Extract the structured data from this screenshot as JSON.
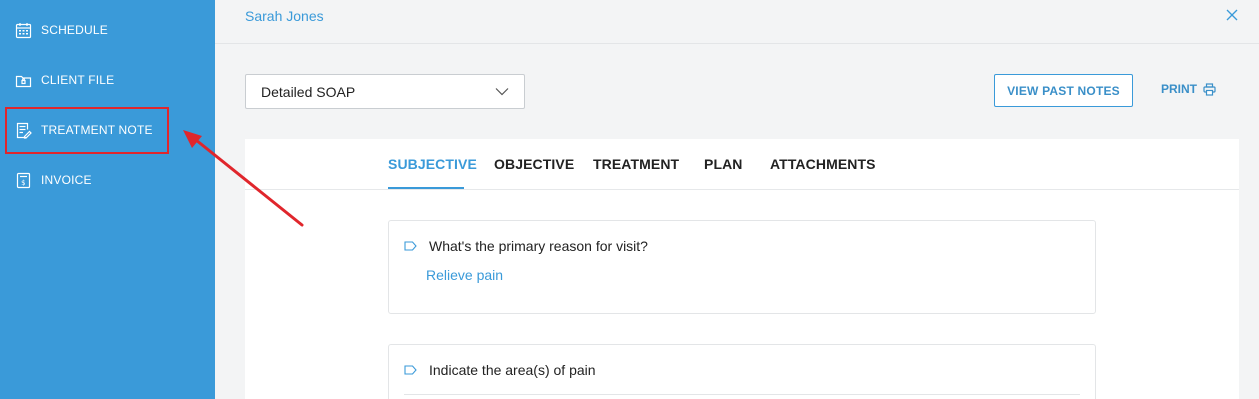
{
  "sidebar": {
    "items": [
      {
        "label": "SCHEDULE",
        "icon": "calendar-icon"
      },
      {
        "label": "CLIENT FILE",
        "icon": "folder-icon"
      },
      {
        "label": "TREATMENT NOTE",
        "icon": "note-edit-icon"
      },
      {
        "label": "INVOICE",
        "icon": "invoice-icon"
      }
    ],
    "highlighted_item": "TREATMENT NOTE"
  },
  "header": {
    "client_name": "Sarah Jones",
    "close_icon": "close-icon"
  },
  "toolbar": {
    "note_type_value": "Detailed SOAP",
    "view_past_notes_label": "VIEW PAST NOTES",
    "print_label": "PRINT"
  },
  "tabs": [
    {
      "label": "SUBJECTIVE",
      "active": true
    },
    {
      "label": "OBJECTIVE",
      "active": false
    },
    {
      "label": "TREATMENT",
      "active": false
    },
    {
      "label": "PLAN",
      "active": false
    },
    {
      "label": "ATTACHMENTS",
      "active": false
    }
  ],
  "questions": [
    {
      "question": "What's the primary reason for visit?",
      "answer": "Relieve pain"
    },
    {
      "question": "Indicate the area(s) of pain",
      "answer": ""
    }
  ],
  "colors": {
    "sidebar_bg": "#3a9ad9",
    "accent": "#3a9ad9",
    "annotation_red": "#e0262c",
    "page_bg": "#f3f4f5"
  }
}
